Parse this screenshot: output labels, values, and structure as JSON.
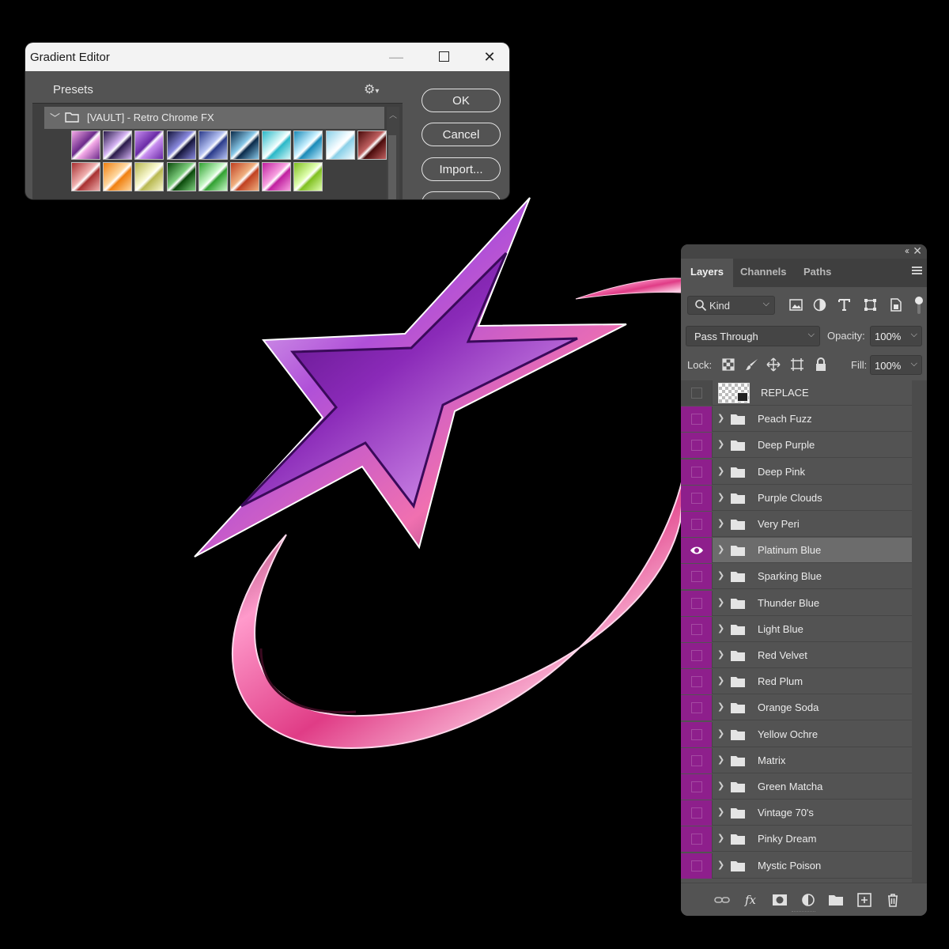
{
  "gradient_editor": {
    "title": "Gradient Editor",
    "presets_label": "Presets",
    "group_label": "[VAULT] - Retro Chrome FX",
    "buttons": {
      "ok": "OK",
      "cancel": "Cancel",
      "import": "Import..."
    },
    "swatches": [
      [
        "#f3a8e6",
        "#6b2a8a"
      ],
      [
        "#2a1a4a",
        "#d6b4f4"
      ],
      [
        "#c88ef0",
        "#6a2aa6"
      ],
      [
        "#14143a",
        "#8a8ae0"
      ],
      [
        "#2a3a8a",
        "#b8c4f4"
      ],
      [
        "#0a2a4a",
        "#88c8e8"
      ],
      [
        "#2ab8c8",
        "#d8f8f8"
      ],
      [
        "#1a8ab8",
        "#c8f0ff"
      ],
      [
        "#8ad0e8",
        "#f4fcff"
      ],
      [
        "#4a0a0a",
        "#c06060"
      ],
      [
        "#a83030",
        "#f0b0b0"
      ],
      [
        "#f08010",
        "#ffd8a0"
      ],
      [
        "#b8b850",
        "#f8f8d0"
      ],
      [
        "#0a4a0a",
        "#80d080"
      ],
      [
        "#30a030",
        "#c8f8c8"
      ],
      [
        "#c04020",
        "#f0b080"
      ],
      [
        "#c020a0",
        "#f8a0e0"
      ],
      [
        "#80c020",
        "#e0ffb0"
      ]
    ]
  },
  "layers_panel": {
    "tabs": [
      "Layers",
      "Channels",
      "Paths"
    ],
    "filter_kind": "Kind",
    "blend_mode": "Pass Through",
    "opacity_label": "Opacity:",
    "opacity": "100%",
    "lock_label": "Lock:",
    "fill_label": "Fill:",
    "fill": "100%",
    "layers": [
      {
        "name": "REPLACE",
        "type": "smart-object",
        "visible": false
      },
      {
        "name": "Peach Fuzz",
        "type": "group",
        "visible": false
      },
      {
        "name": "Deep Purple",
        "type": "group",
        "visible": false
      },
      {
        "name": "Deep Pink",
        "type": "group",
        "visible": false
      },
      {
        "name": "Purple Clouds",
        "type": "group",
        "visible": false
      },
      {
        "name": "Very Peri",
        "type": "group",
        "visible": false
      },
      {
        "name": "Platinum Blue",
        "type": "group",
        "visible": true,
        "selected": true
      },
      {
        "name": "Sparking Blue",
        "type": "group",
        "visible": false
      },
      {
        "name": "Thunder Blue",
        "type": "group",
        "visible": false
      },
      {
        "name": "Light Blue",
        "type": "group",
        "visible": false
      },
      {
        "name": "Red Velvet",
        "type": "group",
        "visible": false
      },
      {
        "name": "Red Plum",
        "type": "group",
        "visible": false
      },
      {
        "name": "Orange Soda",
        "type": "group",
        "visible": false
      },
      {
        "name": "Yellow Ochre",
        "type": "group",
        "visible": false
      },
      {
        "name": "Matrix",
        "type": "group",
        "visible": false
      },
      {
        "name": "Green Matcha",
        "type": "group",
        "visible": false
      },
      {
        "name": "Vintage 70's",
        "type": "group",
        "visible": false
      },
      {
        "name": "Pinky Dream",
        "type": "group",
        "visible": false
      },
      {
        "name": "Mystic Poison",
        "type": "group",
        "visible": false
      }
    ],
    "bottom_icons": [
      "link-layers-icon",
      "fx-icon",
      "layer-mask-icon",
      "adjustment-layer-icon",
      "new-group-icon",
      "new-layer-icon",
      "delete-icon"
    ]
  },
  "colors": {
    "visibility_column": "#8e1f8c",
    "panel_bg": "#535353",
    "star_purple": "#7a1aa0",
    "swoosh_pink": "#e0408a"
  }
}
